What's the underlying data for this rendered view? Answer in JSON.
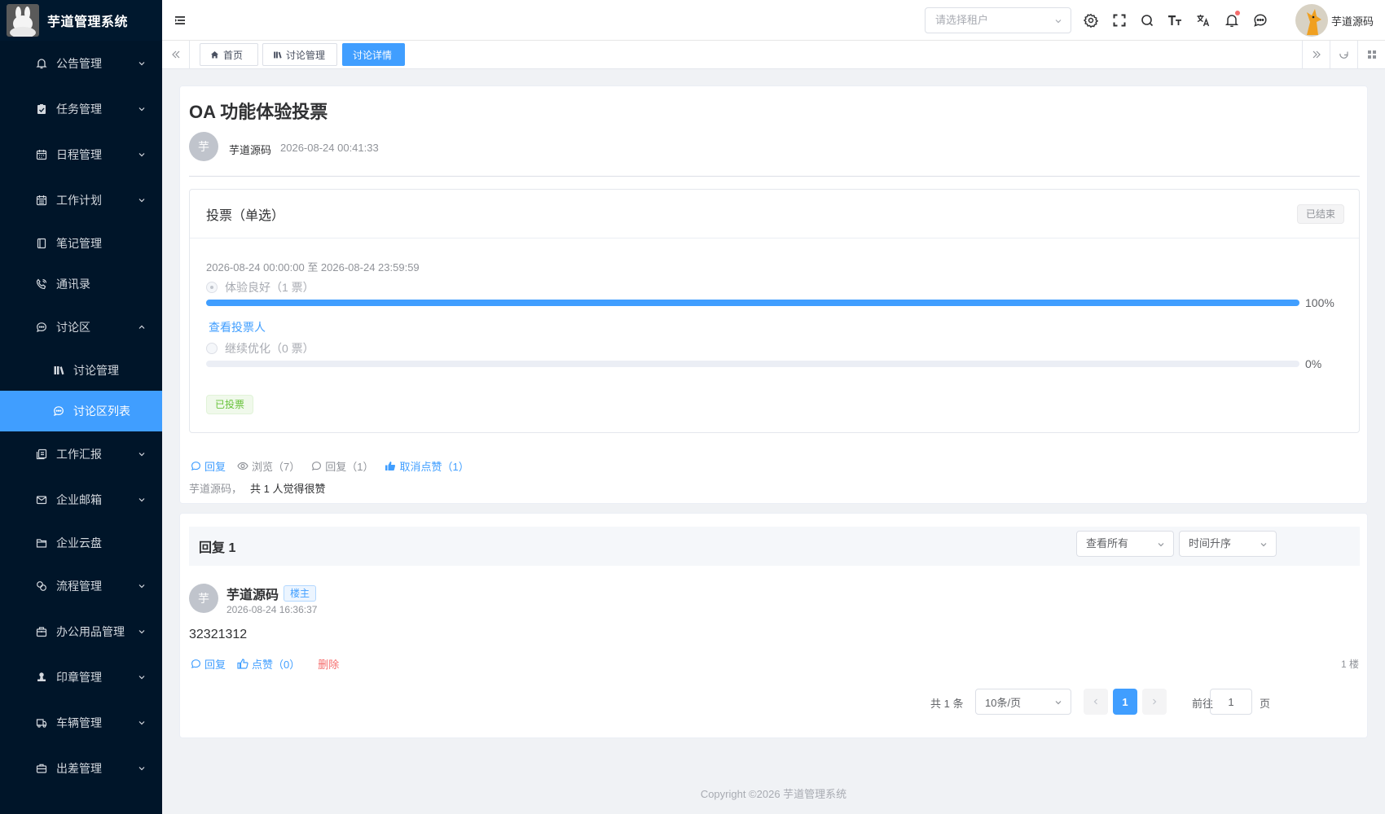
{
  "app": {
    "title": "芋道管理系统"
  },
  "sidebar": {
    "items": [
      {
        "label": "公告管理",
        "icon": "bell-icon"
      },
      {
        "label": "任务管理",
        "icon": "clipboard-check-icon"
      },
      {
        "label": "日程管理",
        "icon": "calendar-icon"
      },
      {
        "label": "工作计划",
        "icon": "calendar-grid-icon"
      },
      {
        "label": "笔记管理",
        "icon": "notebook-icon"
      },
      {
        "label": "通讯录",
        "icon": "phone-icon"
      },
      {
        "label": "讨论区",
        "icon": "chat-icon"
      },
      {
        "label": "讨论管理",
        "icon": "books-icon"
      },
      {
        "label": "讨论区列表",
        "icon": "chat-icon"
      },
      {
        "label": "工作汇报",
        "icon": "report-icon"
      },
      {
        "label": "企业邮箱",
        "icon": "mail-icon"
      },
      {
        "label": "企业云盘",
        "icon": "folder-icon"
      },
      {
        "label": "流程管理",
        "icon": "flow-icon"
      },
      {
        "label": "办公用品管理",
        "icon": "package-icon"
      },
      {
        "label": "印章管理",
        "icon": "stamp-icon"
      },
      {
        "label": "车辆管理",
        "icon": "truck-icon"
      },
      {
        "label": "出差管理",
        "icon": "briefcase-icon"
      }
    ]
  },
  "header": {
    "tenant_placeholder": "请选择租户",
    "username": "芋道源码",
    "notification_dot_color": "#f56c6c"
  },
  "tags": [
    {
      "label": "首页"
    },
    {
      "label": "讨论管理"
    },
    {
      "label": "讨论详情"
    }
  ],
  "post": {
    "title": "OA 功能体验投票",
    "author_initial": "芋",
    "author": "芋道源码",
    "time": "2026-08-24 00:41:33",
    "vote": {
      "heading": "投票（单选）",
      "status": "已结束",
      "range": "2026-08-24 00:00:00 至 2026-08-24 23:59:59",
      "options": [
        {
          "label": "体验良好（1 票）",
          "percent": 100,
          "percent_text": "100%"
        },
        {
          "label": "继续优化（0 票）",
          "percent": 0,
          "percent_text": "0%"
        }
      ],
      "view_voters": "查看投票人",
      "voted_tag": "已投票"
    },
    "actions": {
      "reply": "回复",
      "views": "浏览（7）",
      "replies": "回复（1）",
      "unlike": "取消点赞（1）"
    },
    "likers_names": "芋道源码，",
    "likers_summary": "共 1 人觉得很赞"
  },
  "replies": {
    "heading": "回复 1",
    "filter": "查看所有",
    "sort": "时间升序",
    "items": [
      {
        "initial": "芋",
        "author": "芋道源码",
        "badge": "楼主",
        "time": "2026-08-24 16:36:37",
        "content": "32321312",
        "reply": "回复",
        "like": "点赞（0）",
        "delete": "删除",
        "floor": "1 楼"
      }
    ],
    "pagination": {
      "total": "共 1 条",
      "page_size": "10条/页",
      "current_page": "1",
      "goto_label": "前往",
      "goto_value": "1",
      "page_suffix": "页"
    }
  },
  "footer": {
    "copyright": "Copyright ©2026 芋道管理系统"
  }
}
